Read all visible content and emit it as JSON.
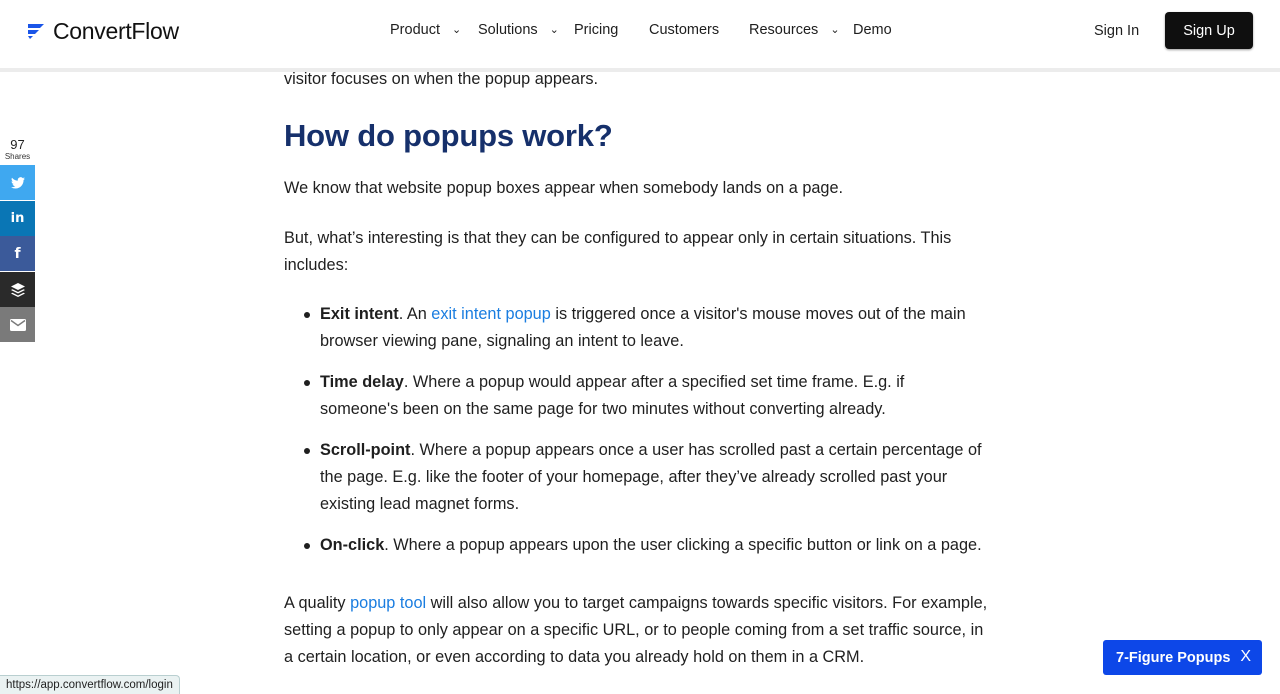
{
  "header": {
    "logo_text": "ConvertFlow",
    "nav": [
      {
        "label": "Product",
        "has_dropdown": true
      },
      {
        "label": "Solutions",
        "has_dropdown": true
      },
      {
        "label": "Pricing",
        "has_dropdown": false
      },
      {
        "label": "Customers",
        "has_dropdown": false
      },
      {
        "label": "Resources",
        "has_dropdown": true
      },
      {
        "label": "Demo",
        "has_dropdown": false
      }
    ],
    "sign_in": "Sign In",
    "sign_up": "Sign Up"
  },
  "share": {
    "count": "97",
    "count_label": "Shares",
    "buttons": [
      "twitter-icon",
      "linkedin-icon",
      "facebook-icon",
      "buffer-icon",
      "email-icon"
    ]
  },
  "article": {
    "intro_fragment": "visitor focuses on when the popup appears.",
    "heading": "How do popups work?",
    "p1": "We know that website popup boxes appear when somebody lands on a page.",
    "p2": "But, what’s interesting is that they can be configured to appear only in certain situations. This includes:",
    "list": [
      {
        "term": "Exit intent",
        "pre": ". An ",
        "link": "exit intent popup",
        "post": " is triggered once a visitor's mouse moves out of the main browser viewing pane, signaling an intent to leave."
      },
      {
        "term": "Time delay",
        "text": ". Where a popup would appear after a specified set time frame. E.g. if someone's been on the same page for two minutes without converting already."
      },
      {
        "term": "Scroll-point",
        "text": ". Where a popup appears once a user has scrolled past a certain percentage of the page. E.g. like the footer of your homepage, after they’ve already scrolled past your existing lead magnet forms."
      },
      {
        "term": "On-click",
        "text": ". Where a popup appears upon the user clicking a specific button or link on a page."
      }
    ],
    "p3_pre": "A quality ",
    "p3_link": "popup tool",
    "p3_post": " will also allow you to target campaigns towards specific visitors. For example, setting a popup to only appear on a specific URL, or to people coming from a set traffic source, in a certain location, or even according to data you already hold on them in a CRM."
  },
  "status_url": "https://app.convertflow.com/login",
  "cta": {
    "label": "7-Figure Popups",
    "close": "X"
  },
  "colors": {
    "heading": "#16306b",
    "link": "#1a7de0",
    "cta": "#0d47e8",
    "signup_bg": "#0f0f0f"
  }
}
